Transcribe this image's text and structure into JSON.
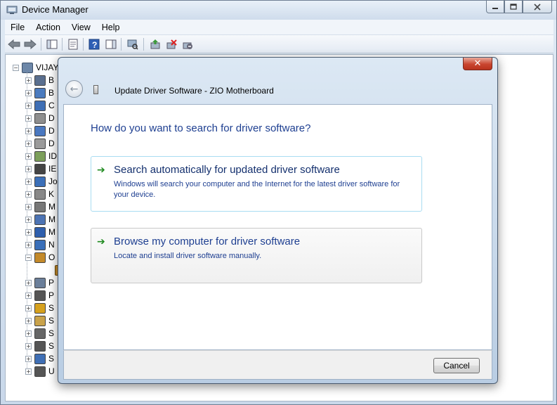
{
  "main_window": {
    "title": "Device Manager",
    "window_buttons": [
      "minimize",
      "maximize",
      "close"
    ],
    "menu": [
      "File",
      "Action",
      "View",
      "Help"
    ]
  },
  "toolbar": {
    "icons": [
      "back-arrow-icon",
      "forward-arrow-icon",
      "show-hide-console-tree-icon",
      "properties-icon",
      "help-icon",
      "action-pane-icon",
      "scan-hardware-icon",
      "update-driver-icon",
      "uninstall-icon",
      "disable-icon"
    ]
  },
  "tree": {
    "root_label": "VIJAY",
    "rows": [
      {
        "label": "B",
        "color": "#5a6f8f"
      },
      {
        "label": "B",
        "color": "#4b7bbf"
      },
      {
        "label": "C",
        "color": "#3f6fb5"
      },
      {
        "label": "D",
        "color": "#8e8e8e"
      },
      {
        "label": "D",
        "color": "#4a78c0"
      },
      {
        "label": "D",
        "color": "#9a9a9a"
      },
      {
        "label": "ID",
        "color": "#7c9f5a"
      },
      {
        "label": "IE",
        "color": "#444444"
      },
      {
        "label": "Jo",
        "color": "#3b6fb8"
      },
      {
        "label": "K",
        "color": "#888888"
      },
      {
        "label": "M",
        "color": "#777777"
      },
      {
        "label": "M",
        "color": "#4d74b4"
      },
      {
        "label": "M",
        "color": "#2f5fad"
      },
      {
        "label": "N",
        "color": "#3a6fb9"
      },
      {
        "label": "O",
        "color": "#c48a2a"
      },
      {
        "label": "P",
        "color": "#6b7f9a"
      },
      {
        "label": "P",
        "color": "#555555"
      },
      {
        "label": "S",
        "color": "#d6a11e"
      },
      {
        "label": "S",
        "color": "#c9a24a"
      },
      {
        "label": "S",
        "color": "#666666"
      },
      {
        "label": "S",
        "color": "#555555"
      },
      {
        "label": "S",
        "color": "#3f6fb5"
      },
      {
        "label": "U",
        "color": "#555555"
      }
    ]
  },
  "dialog": {
    "title": "Update Driver Software - ZIO Motherboard",
    "question": "How do you want to search for driver software?",
    "options": [
      {
        "title": "Search automatically for updated driver software",
        "description": "Windows will search your computer and the Internet for the latest driver software for your device."
      },
      {
        "title": "Browse my computer for driver software",
        "description": "Locate and install driver software manually."
      }
    ],
    "cancel_label": "Cancel",
    "close_glyph": "✕"
  }
}
